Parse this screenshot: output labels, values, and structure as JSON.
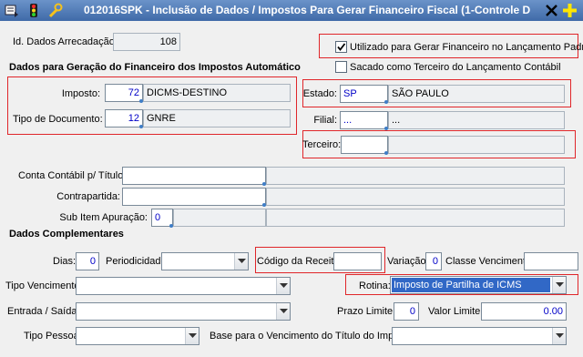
{
  "window": {
    "title": "012016SPK - Inclusão de Dados / Impostos  Para Gerar Financeiro Fiscal (1-Controle D",
    "toolbar_icons": [
      "menu-icon",
      "traffic-light-icon",
      "wrench-icon"
    ],
    "close_icon": "close-icon",
    "add_icon": "plus-icon"
  },
  "id_arrecadacao": {
    "label": "Id. Dados Arrecadação:",
    "value": "108"
  },
  "flags": {
    "gerar_financeiro": {
      "label": "Utilizado para Gerar Financeiro no Lançamento Padrão",
      "checked": true
    },
    "sacado_terceiro": {
      "label": "Sacado como Terceiro do Lançamento Contábil",
      "checked": false
    }
  },
  "section_geracao": "Dados para Geração do Financeiro dos Impostos Automático",
  "imposto": {
    "label": "Imposto:",
    "code": "72",
    "desc": "DICMS-DESTINO"
  },
  "tipo_documento": {
    "label": "Tipo de Documento:",
    "code": "12",
    "desc": "GNRE"
  },
  "estado": {
    "label": "Estado:",
    "code": "SP",
    "desc": "SÃO PAULO"
  },
  "filial": {
    "label": "Filial:",
    "code": "...",
    "desc": "..."
  },
  "terceiro": {
    "label": "Terceiro:",
    "code": "",
    "desc": ""
  },
  "conta_contabil": {
    "label": "Conta Contábil p/ Título:",
    "code": "",
    "desc": ""
  },
  "contrapartida": {
    "label": "Contrapartida:",
    "code": "",
    "desc": ""
  },
  "sub_item": {
    "label": "Sub Item Apuração:",
    "code": "0",
    "desc": ""
  },
  "section_complementares": "Dados Complementares",
  "dias": {
    "label": "Dias:",
    "value": "0"
  },
  "periodicidade": {
    "label": "Periodicidade:",
    "value": ""
  },
  "codigo_receita": {
    "label": "Código da Receita:",
    "value": ""
  },
  "variacao": {
    "label": "Variação:",
    "value": "0"
  },
  "classe_vencimento": {
    "label": "Classe Vencimento:",
    "value": ""
  },
  "tipo_vencimento": {
    "label": "Tipo Vencimento:",
    "value": ""
  },
  "rotina": {
    "label": "Rotina:",
    "value": "Imposto de Partilha de ICMS"
  },
  "entrada_saida": {
    "label": "Entrada / Saída:",
    "value": ""
  },
  "prazo_limite": {
    "label": "Prazo Limite:",
    "value": "0"
  },
  "valor_limite": {
    "label": "Valor Limite:",
    "value": "0.00"
  },
  "tipo_pessoa": {
    "label": "Tipo Pessoa:",
    "value": ""
  },
  "base_vencimento": {
    "label": "Base para o Vencimento do Título do Imposto:",
    "value": ""
  },
  "colors": {
    "title_bar": "#4f7bb9",
    "highlight_border": "#e0262a",
    "code_text": "#0000c8",
    "selection": "#3168c6"
  }
}
